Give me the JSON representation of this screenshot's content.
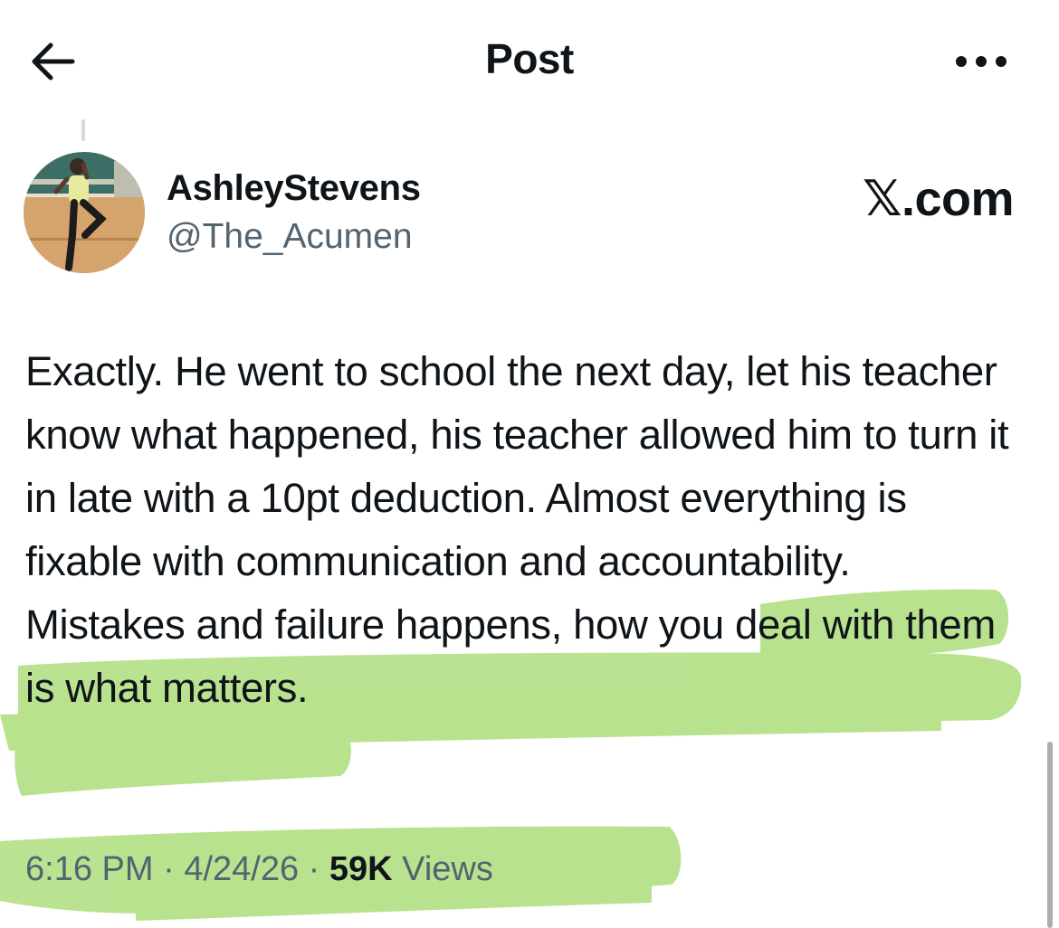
{
  "header": {
    "title": "Post",
    "back_icon": "arrow-left-icon",
    "more_icon": "more-horizontal-icon"
  },
  "author": {
    "display_name": "AshleyStevens",
    "handle": "@The_Acumen"
  },
  "source": "𝕏.com",
  "post": {
    "text_plain": "Exactly. He went to school the next day, let his teacher know what happened, his teacher allowed him to turn it in late with a 10pt deduction. Almost everything is fixable with communication and accountability. ",
    "text_highlighted": "Mistakes and failure happens, how you deal with them is what matters."
  },
  "meta": {
    "time": "6:16 PM",
    "separator": " · ",
    "date": "4/24/26",
    "views_count": "59K",
    "views_label": " Views"
  },
  "colors": {
    "highlight": "#9fd86a",
    "secondary_text": "#536471",
    "primary_text": "#0f1419"
  }
}
